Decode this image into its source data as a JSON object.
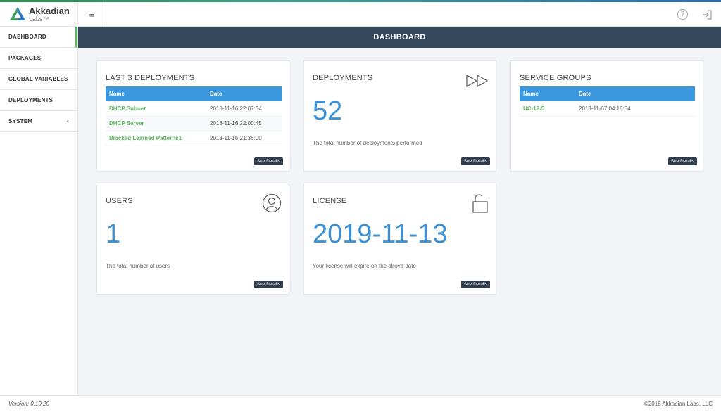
{
  "app": {
    "logo_name": "Akkadian",
    "logo_sub": "Labs",
    "logo_tm": "™",
    "menu_icon": "hamburger-icon",
    "help_icon": "help-icon",
    "logout_icon": "logout-icon"
  },
  "sidebar": {
    "items": [
      {
        "label": "DASHBOARD"
      },
      {
        "label": "PACKAGES"
      },
      {
        "label": "GLOBAL VARIABLES"
      },
      {
        "label": "DEPLOYMENTS"
      },
      {
        "label": "SYSTEM",
        "chevron": "‹"
      }
    ]
  },
  "header": {
    "title": "DASHBOARD"
  },
  "cards": {
    "last_deployments": {
      "title": "LAST 3 DEPLOYMENTS",
      "columns": [
        "Name",
        "Date"
      ],
      "rows": [
        {
          "name": "DHCP Subnet",
          "date": "2018-11-16 22:07:34"
        },
        {
          "name": "DHCP Server",
          "date": "2018-11-16 22:00:45"
        },
        {
          "name": "Blocked Learned Patterns1",
          "date": "2018-11-16 21:36:00"
        }
      ],
      "button": "See Details"
    },
    "deployments": {
      "title": "DEPLOYMENTS",
      "value": "52",
      "caption": "The total number of deployments performed",
      "icon": "fast-forward-icon",
      "button": "See Details"
    },
    "service_groups": {
      "title": "SERVICE GROUPS",
      "columns": [
        "Name",
        "Date"
      ],
      "rows": [
        {
          "name": "UC-12-5",
          "date": "2018-11-07 04:18:54"
        }
      ],
      "button": "See Details"
    },
    "users": {
      "title": "USERS",
      "value": "1",
      "caption": "The total number of users",
      "icon": "user-icon",
      "button": "See Details"
    },
    "license": {
      "title": "LICENSE",
      "value": "2019-11-13",
      "caption": "Your license will expire on the above date",
      "icon": "unlock-icon",
      "button": "See Details"
    }
  },
  "footer": {
    "version": "Version: 0.10.20",
    "copyright": "©2018 Akkadian Labs, LLC"
  },
  "colors": {
    "accent_blue": "#3a97de",
    "header_dark": "#34485c",
    "link_green": "#5cb85c",
    "button_dark": "#2f3d4e"
  }
}
